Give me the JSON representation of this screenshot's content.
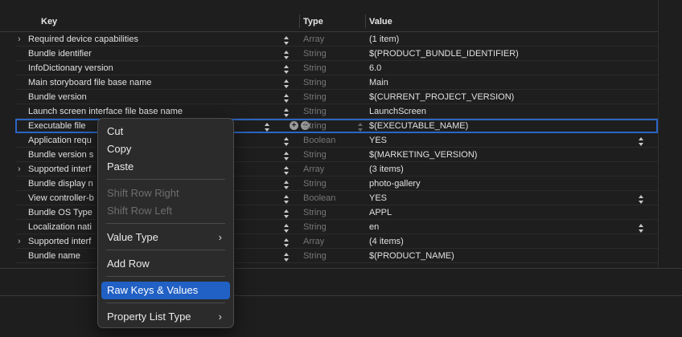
{
  "header": {
    "key": "Key",
    "type": "Type",
    "value": "Value"
  },
  "rows": [
    {
      "key": "Required device capabilities",
      "type": "Array",
      "value": "(1 item)",
      "disclosure": true,
      "value_stepper": false
    },
    {
      "key": "Bundle identifier",
      "type": "String",
      "value": "$(PRODUCT_BUNDLE_IDENTIFIER)",
      "disclosure": false,
      "value_stepper": false
    },
    {
      "key": "InfoDictionary version",
      "type": "String",
      "value": "6.0",
      "disclosure": false,
      "value_stepper": false
    },
    {
      "key": "Main storyboard file base name",
      "type": "String",
      "value": "Main",
      "disclosure": false,
      "value_stepper": false
    },
    {
      "key": "Bundle version",
      "type": "String",
      "value": "$(CURRENT_PROJECT_VERSION)",
      "disclosure": false,
      "value_stepper": false
    },
    {
      "key": "Launch screen interface file base name",
      "type": "String",
      "value": "LaunchScreen",
      "disclosure": false,
      "value_stepper": false
    },
    {
      "key": "Executable file",
      "type": "String",
      "value": "$(EXECUTABLE_NAME)",
      "disclosure": false,
      "value_stepper": false,
      "selected": true
    },
    {
      "key": "Application requ",
      "type": "Boolean",
      "value": "YES",
      "disclosure": false,
      "value_stepper": true
    },
    {
      "key": "Bundle version s",
      "type": "String",
      "value": "$(MARKETING_VERSION)",
      "disclosure": false,
      "value_stepper": false
    },
    {
      "key": "Supported interf",
      "type": "Array",
      "value": "(3 items)",
      "disclosure": true,
      "value_stepper": false
    },
    {
      "key": "Bundle display n",
      "type": "String",
      "value": "photo-gallery",
      "disclosure": false,
      "value_stepper": false
    },
    {
      "key": "View controller-b",
      "type": "Boolean",
      "value": "YES",
      "disclosure": false,
      "value_stepper": true
    },
    {
      "key": "Bundle OS Type",
      "type": "String",
      "value": "APPL",
      "disclosure": false,
      "value_stepper": false
    },
    {
      "key": "Localization nati",
      "type": "String",
      "value": "en",
      "disclosure": false,
      "value_stepper": true
    },
    {
      "key": "Supported interf",
      "type": "Array",
      "value": "(4 items)",
      "disclosure": true,
      "value_stepper": false
    },
    {
      "key": "Bundle name",
      "type": "String",
      "value": "$(PRODUCT_NAME)",
      "disclosure": false,
      "value_stepper": false
    }
  ],
  "selected_row_buttons": {
    "add": "+",
    "remove": "−"
  },
  "menu": {
    "cut": "Cut",
    "copy": "Copy",
    "paste": "Paste",
    "shift_right": "Shift Row Right",
    "shift_left": "Shift Row Left",
    "value_type": "Value Type",
    "add_row": "Add Row",
    "raw_keys": "Raw Keys & Values",
    "plist_type": "Property List Type",
    "submenu_arrow": "›"
  },
  "colors": {
    "highlight": "#2160c4",
    "selection_outline": "#2a65c5",
    "background": "#1e1e1e"
  }
}
